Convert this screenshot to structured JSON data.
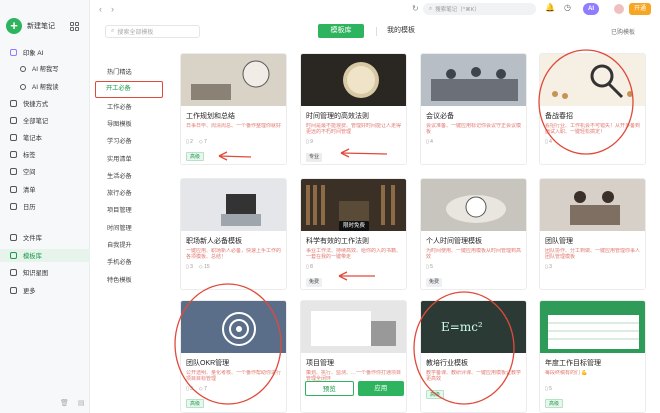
{
  "sidebar": {
    "new_note": "新建笔记",
    "items": [
      {
        "label": "印象 AI",
        "kind": "ai"
      },
      {
        "label": "AI 帮我写",
        "kind": "sub"
      },
      {
        "label": "AI 帮我读",
        "kind": "sub"
      },
      {
        "label": "快捷方式"
      },
      {
        "label": "全部笔记"
      },
      {
        "label": "笔记本"
      },
      {
        "label": "标签"
      },
      {
        "label": "空间"
      },
      {
        "label": "清单"
      },
      {
        "label": "日历"
      },
      {
        "label": "文件库"
      },
      {
        "label": "模板库",
        "active": true
      },
      {
        "label": "知识星图"
      },
      {
        "label": "更多"
      }
    ]
  },
  "topbar": {
    "search_placeholder": "搜索笔记（^⌘K）",
    "ai": "AI",
    "vip": "开通"
  },
  "header": {
    "tpl_search_placeholder": "搜索全部模板",
    "tab_library": "模板库",
    "tab_mine": "我的模板",
    "purchased": "已购模板"
  },
  "categories": [
    "热门精选",
    "开工必备",
    "工作必备",
    "导图模板",
    "学习必备",
    "实用清单",
    "生活必备",
    "旅行必备",
    "项目管理",
    "时间管理",
    "自我提升",
    "手机必备",
    "特色模板"
  ],
  "cards": [
    {
      "title": "工作规划和总结",
      "desc": "日事日毕、周清周总、一个番作整理你就好",
      "meta": [
        "2",
        "7"
      ],
      "badge": "高级",
      "badge_type": "adv",
      "img": "desk"
    },
    {
      "title": "时间管理的高效法则",
      "desc": "时间是最不能浪费、管理好时间能让人走得更远的不朽时间管理",
      "meta": [
        "9"
      ],
      "badge": "专业",
      "badge_type": "pro",
      "img": "clock"
    },
    {
      "title": "会议必备",
      "desc": "会议准备、一键应用标记你会议守正会议模板",
      "meta": [
        "4"
      ],
      "badge": "",
      "badge_type": "",
      "img": "meeting"
    },
    {
      "title": "备战春招",
      "desc": "看招行业、工作机会不可错失！从开多备到面试入职、一键轻松搞定！",
      "meta": [
        "4"
      ],
      "badge": "",
      "badge_type": "",
      "img": "magnify"
    },
    {
      "title": "职场新人必备模板",
      "desc": "一键应用、职场新人必备，快速上手工作的各项模板、总结！",
      "meta": [
        "3",
        "15"
      ],
      "badge": "",
      "badge_type": "",
      "img": "office"
    },
    {
      "title": "科学有效的工作法则",
      "desc": "事业工作法、持续高效、给你的入的书籍、一套在我的一键带走",
      "meta": [
        "8"
      ],
      "badge": "免费",
      "badge_type": "free",
      "img": "books",
      "overlay": "限时免费"
    },
    {
      "title": "个人时间管理模板",
      "desc": "为时间使用、一键应用模板从时间管理到高效",
      "meta": [
        "5"
      ],
      "badge": "免费",
      "badge_type": "free",
      "img": "sandclock"
    },
    {
      "title": "团队管理",
      "desc": "团队协作、分工到做、一键应用管理你事人团队管理模板",
      "meta": [
        "3"
      ],
      "badge": "",
      "badge_type": "",
      "img": "team"
    },
    {
      "title": "团队OKR管理",
      "desc": "公开透明、量化考核、一个番作帮助你进行项目目标管理",
      "meta": [
        "3",
        "7"
      ],
      "badge": "高级",
      "badge_type": "adv",
      "img": "target"
    },
    {
      "title": "项目管理",
      "desc": "策划、执行、监测、…一个番作你打通项目管理全闭环",
      "meta": [],
      "badge": "",
      "badge_type": "",
      "img": "desk2",
      "buttons": [
        "预览",
        "应用"
      ]
    },
    {
      "title": "教培行业模板",
      "desc": "教学备课、教研评课、一键应用模板让教学更高效",
      "meta": [],
      "badge": "高级",
      "badge_type": "adv",
      "img": "chalk"
    },
    {
      "title": "年度工作目标管理",
      "desc": "每段终稿有的们 💪",
      "meta": [
        "5"
      ],
      "badge": "高级",
      "badge_type": "adv",
      "img": "sheet"
    }
  ],
  "colors": {
    "brand": "#2eb35e",
    "annotation": "#e04a3a",
    "ai": "#8e7dff",
    "vip": "#f6a623"
  }
}
